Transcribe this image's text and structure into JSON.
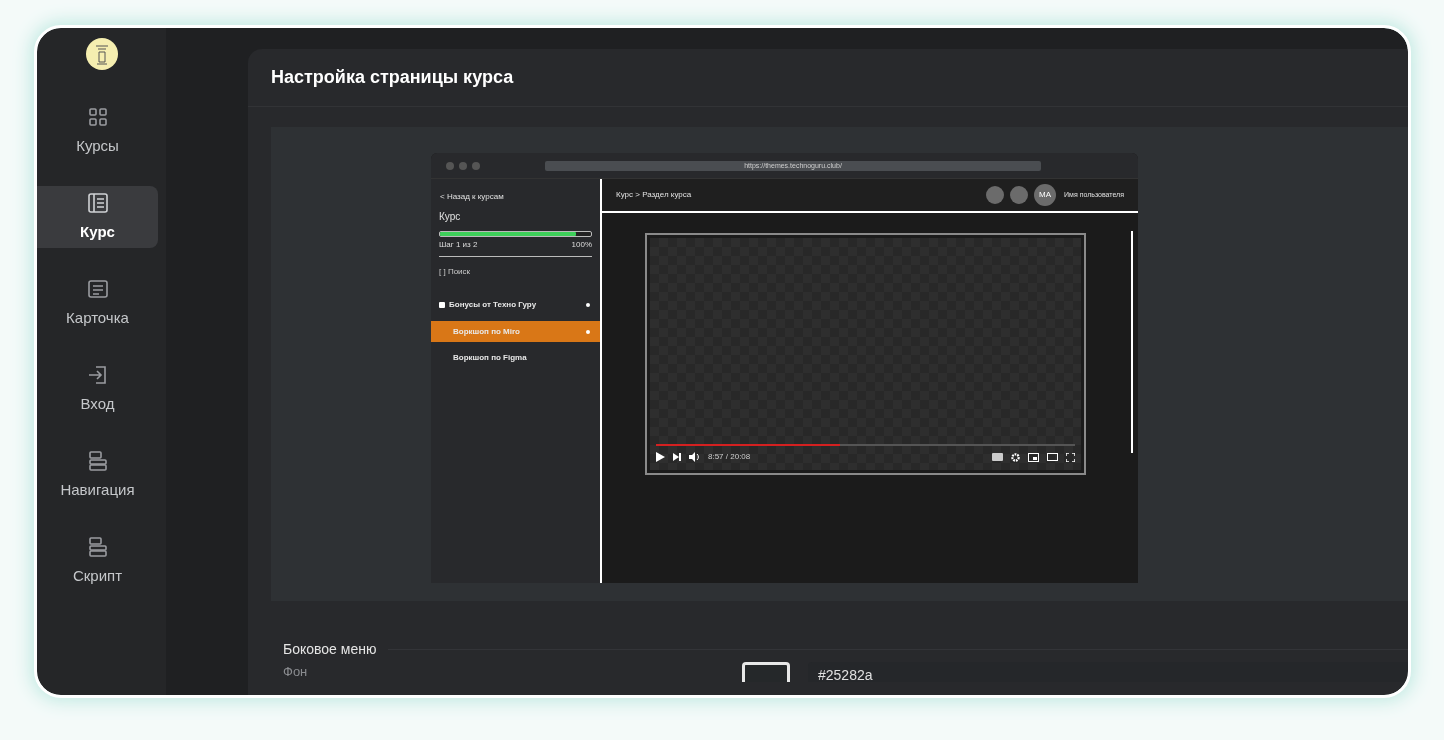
{
  "sidebar": {
    "items": [
      {
        "label": "Курсы",
        "selected": false
      },
      {
        "label": "Курс",
        "selected": true
      },
      {
        "label": "Карточка",
        "selected": false
      },
      {
        "label": "Вход",
        "selected": false
      },
      {
        "label": "Навигация",
        "selected": false
      },
      {
        "label": "Скрипт",
        "selected": false
      }
    ]
  },
  "header": {
    "title": "Настройка страницы курса"
  },
  "preview": {
    "url": "https://themes.technoguru.club/",
    "back_link": "< Назад к курсам",
    "course_title": "Курс",
    "progress": {
      "level": 0.9,
      "step": "Шаг 1 из 2",
      "percent": "100%"
    },
    "search": "[ ] Поиск",
    "lessons": [
      {
        "kind": "group",
        "label": "Бонусы от Техно Гуру",
        "selected": false,
        "children": [
          {
            "kind": "lesson",
            "label": "Воркшоп по Miro",
            "selected": true
          },
          {
            "kind": "lesson",
            "label": "Воркшоп по Figma",
            "selected": false
          }
        ]
      }
    ],
    "breadcrumb": "Курс > Раздел курса",
    "avatar": "MA",
    "username": "Имя пользователя",
    "video": {
      "level": 0.44,
      "time": "8:57 / 20:08"
    }
  },
  "section": {
    "title": "Боковое меню",
    "fields": [
      {
        "label": "Фон",
        "value": "#25282a"
      }
    ]
  }
}
